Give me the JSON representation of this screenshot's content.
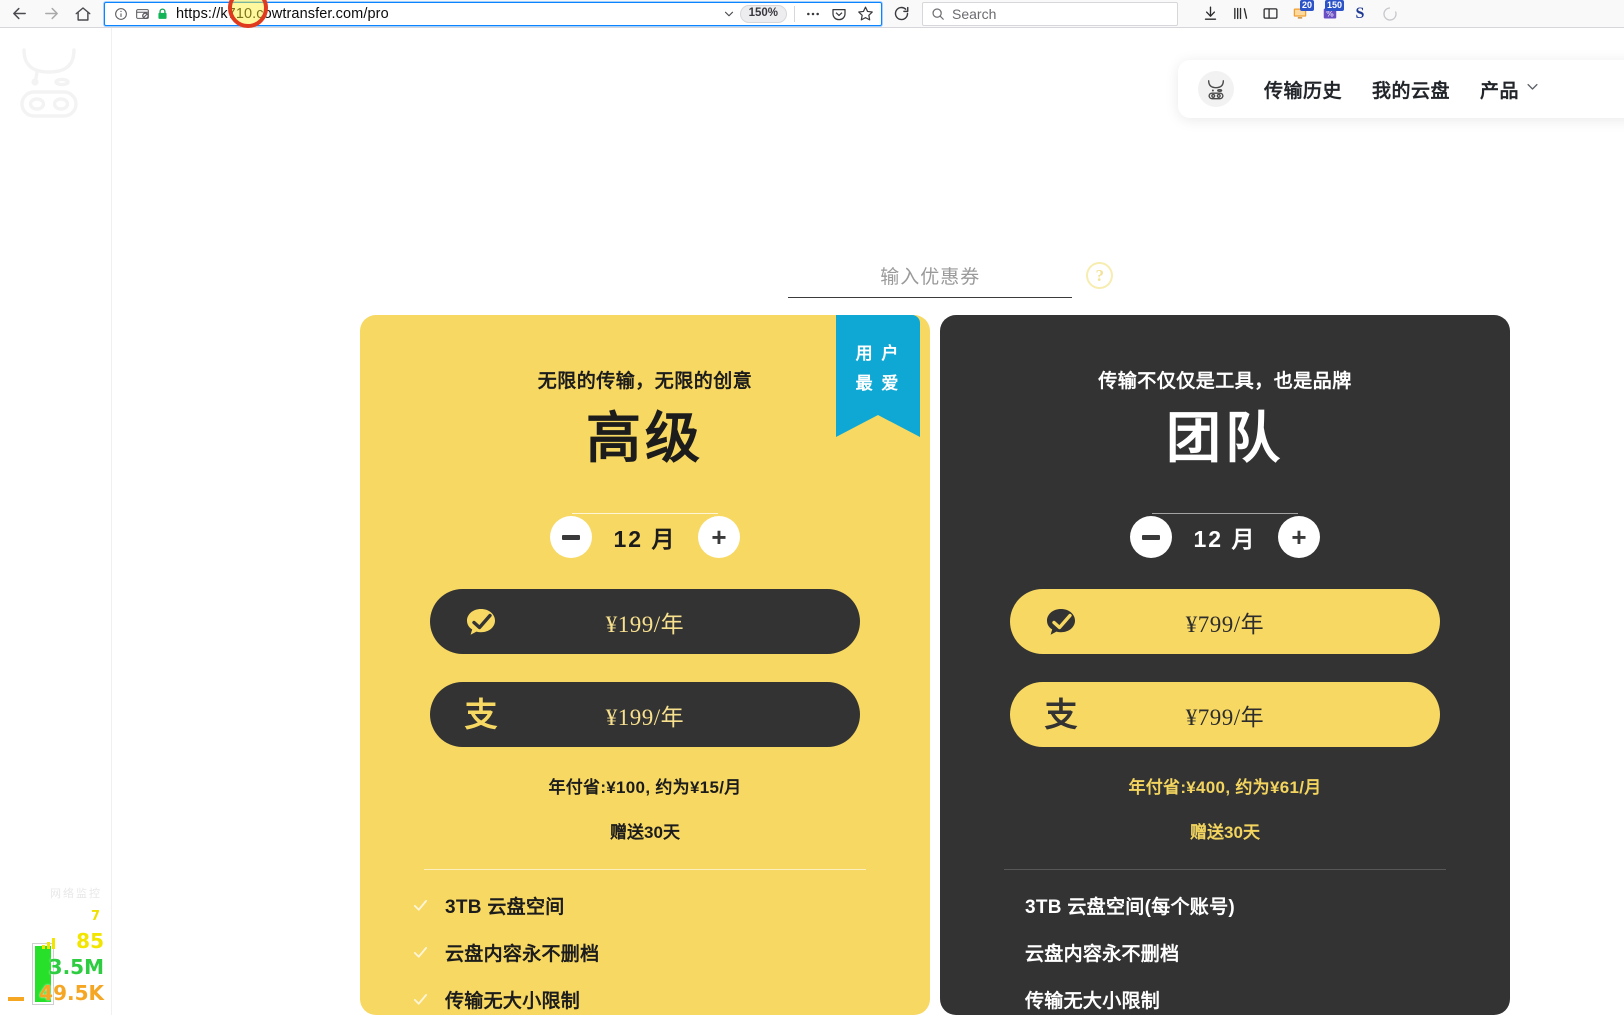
{
  "browser": {
    "url": "https://k710.cowtransfer.com/pro",
    "zoom_level": "150%",
    "search_placeholder": "Search",
    "back_icon": "back-arrow-icon",
    "forward_icon": "forward-arrow-icon",
    "home_icon": "home-icon",
    "identity_icon": "page-info-icon",
    "tracking_icon": "tracking-protection-icon",
    "lock_icon": "padlock-icon",
    "extensions": [
      {
        "name": "downloads-icon",
        "badge": ""
      },
      {
        "name": "library-icon",
        "badge": ""
      },
      {
        "name": "sidebar-icon",
        "badge": ""
      },
      {
        "name": "extension-orange-icon",
        "badge": "20"
      },
      {
        "name": "extension-percent-icon",
        "badge": "150"
      },
      {
        "name": "extension-s-icon",
        "badge": "S"
      }
    ]
  },
  "site_nav": {
    "avatar_icon": "cow-face-icon",
    "items": [
      {
        "label": "传输历史",
        "has_chevron": false
      },
      {
        "label": "我的云盘",
        "has_chevron": false
      },
      {
        "label": "产品",
        "has_chevron": true
      }
    ]
  },
  "coupon": {
    "placeholder": "输入优惠券",
    "help_icon": "question-mark-icon",
    "help_glyph": "?"
  },
  "cards": [
    {
      "id": "premium",
      "tagline": "无限的传输，无限的创意",
      "title": "高级",
      "ribbon": "用户最爱",
      "ribbon_lines": [
        "用 户",
        "最 爱"
      ],
      "ribbon_color": "#0fa8d4",
      "bg_color": "#f7d862",
      "stepper": {
        "value": "12 月",
        "minus": "−",
        "plus": "+"
      },
      "pay_options": [
        {
          "icon": "wechat-pay-icon",
          "price": "¥199/年"
        },
        {
          "icon": "alipay-icon",
          "price": "¥199/年"
        }
      ],
      "save_line": "年付省:¥100, 约为¥15/月",
      "gift_line": "赠送30天",
      "features": [
        "3TB 云盘空间",
        "云盘内容永不删档",
        "传输无大小限制"
      ]
    },
    {
      "id": "team",
      "tagline": "传输不仅仅是工具，也是品牌",
      "title": "团队",
      "ribbon": "",
      "ribbon_lines": [],
      "ribbon_color": "",
      "bg_color": "#333333",
      "stepper": {
        "value": "12 月",
        "minus": "−",
        "plus": "+"
      },
      "pay_options": [
        {
          "icon": "wechat-pay-icon",
          "price": "¥799/年"
        },
        {
          "icon": "alipay-icon",
          "price": "¥799/年"
        }
      ],
      "save_line": "年付省:¥400, 约为¥61/月",
      "gift_line": "赠送30天",
      "features": [
        "3TB 云盘空间(每个账号)",
        "云盘内容永不删档",
        "传输无大小限制"
      ]
    }
  ],
  "net_monitor": {
    "title": "网络监控",
    "sub": "7",
    "signal": "85",
    "down": "3.5M",
    "up": "49.5K"
  },
  "watermark": {
    "icon": "cow-logo-icon"
  }
}
